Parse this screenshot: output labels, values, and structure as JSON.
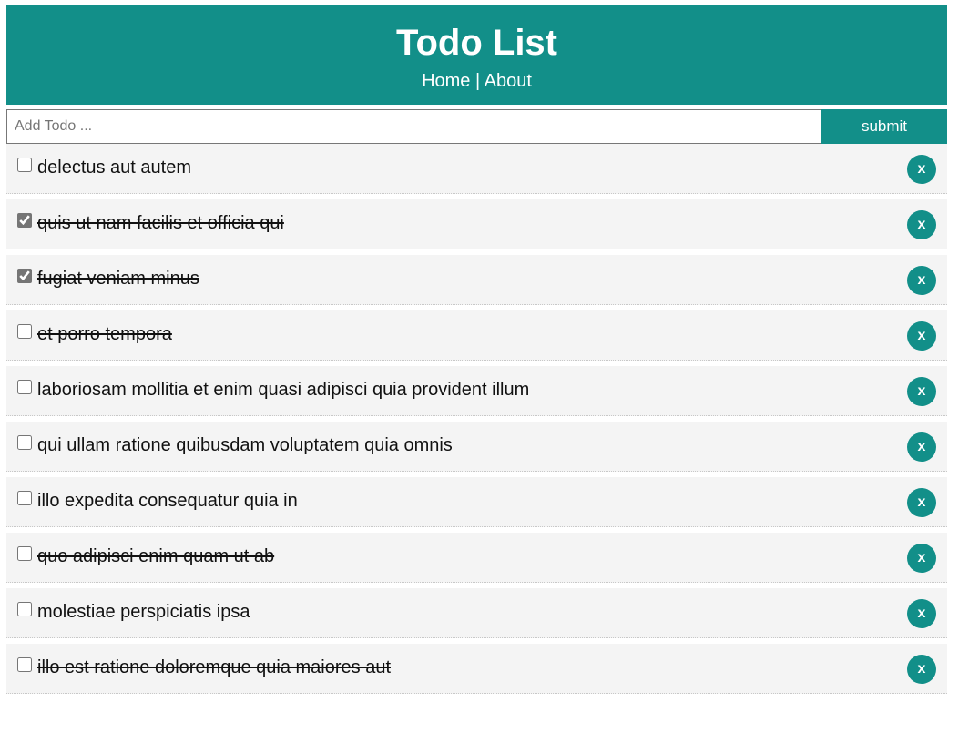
{
  "header": {
    "title": "Todo List",
    "nav": {
      "home": "Home",
      "separator": " | ",
      "about": "About"
    },
    "background_color": "#128f89"
  },
  "form": {
    "input_placeholder": "Add Todo ...",
    "input_value": "",
    "submit_label": "submit"
  },
  "todos": [
    {
      "title": "delectus aut autem",
      "checked": false,
      "struck": false,
      "delete_label": "x"
    },
    {
      "title": "quis ut nam facilis et officia qui",
      "checked": true,
      "struck": true,
      "delete_label": "x"
    },
    {
      "title": "fugiat veniam minus",
      "checked": true,
      "struck": true,
      "delete_label": "x"
    },
    {
      "title": "et porro tempora",
      "checked": false,
      "struck": true,
      "delete_label": "x"
    },
    {
      "title": "laboriosam mollitia et enim quasi adipisci quia provident illum",
      "checked": false,
      "struck": false,
      "delete_label": "x"
    },
    {
      "title": "qui ullam ratione quibusdam voluptatem quia omnis",
      "checked": false,
      "struck": false,
      "delete_label": "x"
    },
    {
      "title": "illo expedita consequatur quia in",
      "checked": false,
      "struck": false,
      "delete_label": "x"
    },
    {
      "title": "quo adipisci enim quam ut ab",
      "checked": false,
      "struck": true,
      "delete_label": "x"
    },
    {
      "title": "molestiae perspiciatis ipsa",
      "checked": false,
      "struck": false,
      "delete_label": "x"
    },
    {
      "title": "illo est ratione doloremque quia maiores aut",
      "checked": false,
      "struck": true,
      "delete_label": "x"
    }
  ]
}
